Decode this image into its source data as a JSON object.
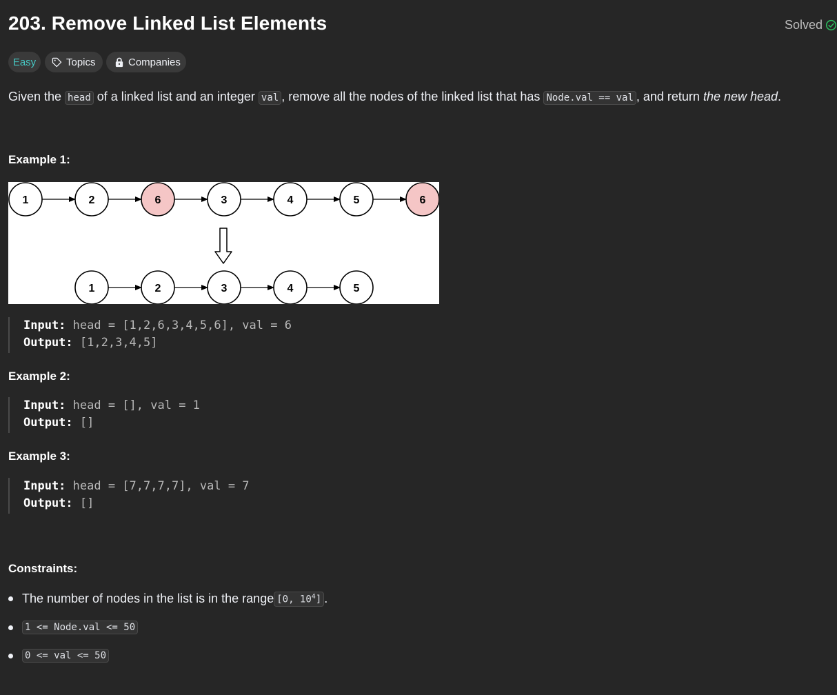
{
  "problem": {
    "title": "203. Remove Linked List Elements",
    "status_label": "Solved",
    "difficulty": "Easy",
    "topics_label": "Topics",
    "companies_label": "Companies",
    "description": {
      "p1": "Given the ",
      "c1": "head",
      "p2": " of a linked list and an integer ",
      "c2": "val",
      "p3": ", remove all the nodes of the linked list that has ",
      "c3": "Node.val == val",
      "p4": ", and return ",
      "em": "the new head",
      "p5": "."
    }
  },
  "examples": [
    {
      "heading": "Example 1:",
      "input_label": "Input:",
      "input_value": "head = [1,2,6,3,4,5,6], val = 6",
      "output_label": "Output:",
      "output_value": "[1,2,3,4,5]",
      "diagram": {
        "before": [
          "1",
          "2",
          "6",
          "3",
          "4",
          "5",
          "6"
        ],
        "removed_highlight": [
          false,
          false,
          true,
          false,
          false,
          false,
          true
        ],
        "after": [
          "1",
          "2",
          "3",
          "4",
          "5"
        ]
      }
    },
    {
      "heading": "Example 2:",
      "input_label": "Input:",
      "input_value": "head = [], val = 1",
      "output_label": "Output:",
      "output_value": "[]"
    },
    {
      "heading": "Example 3:",
      "input_label": "Input:",
      "input_value": "head = [7,7,7,7], val = 7",
      "output_label": "Output:",
      "output_value": "[]"
    }
  ],
  "constraints": {
    "heading": "Constraints:",
    "c1_text": "The number of nodes in the list is in the range ",
    "c1_code_prefix": "[0, 10",
    "c1_code_sup": "4",
    "c1_code_suffix": "]",
    "c1_after": ".",
    "c2_code": "1 <= Node.val <= 50",
    "c3_code": "0 <= val <= 50"
  },
  "colors": {
    "background": "#262626",
    "easy": "#46c6c2",
    "solved_check": "#2cbb5d",
    "removed_node_fill": "#f5c6c6"
  },
  "icons": {
    "solved": "check-circle-icon",
    "topics": "tag-icon",
    "companies": "lock-icon",
    "transform_arrow": "down-arrow-icon"
  }
}
